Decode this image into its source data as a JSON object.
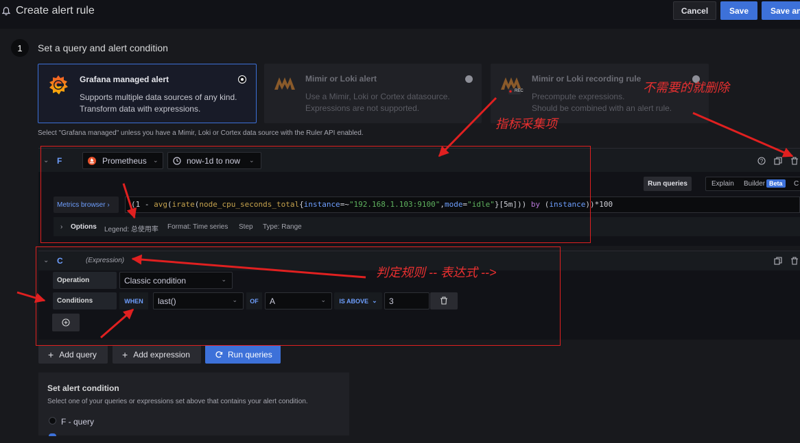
{
  "header": {
    "title": "Create alert rule",
    "cancel": "Cancel",
    "save": "Save",
    "save_exit": "Save and exit"
  },
  "step": {
    "number": "1",
    "title": "Set a query and alert condition"
  },
  "rule_types": [
    {
      "title": "Grafana managed alert",
      "line1": "Supports multiple data sources of any kind.",
      "line2": "Transform data with expressions.",
      "selected": true
    },
    {
      "title": "Mimir or Loki alert",
      "line1": "Use a Mimir, Loki or Cortex datasource.",
      "line2": "Expressions are not supported.",
      "selected": false
    },
    {
      "title": "Mimir or Loki recording rule",
      "line1": "Precompute expressions.",
      "line2": "Should be combined with an alert rule.",
      "selected": false,
      "badge": "REC"
    }
  ],
  "hint": "Select \"Grafana managed\" unless you have a Mimir, Loki or Cortex data source with the Ruler API enabled.",
  "query_f": {
    "ref": "F",
    "datasource": "Prometheus",
    "time_range": "now-1d to now",
    "run_queries": "Run queries",
    "mode": {
      "explain": "Explain",
      "builder": "Builder",
      "beta": "Beta",
      "code": "C"
    },
    "metrics_browser": "Metrics browser ›",
    "expr": {
      "p1": "(1 - ",
      "fn1": "avg",
      "p2": "(",
      "fn2": "irate",
      "p3": "(",
      "metric": "node_cpu_seconds_total",
      "p4": "{",
      "l1": "instance",
      "op1": "=~",
      "s1": "\"192.168.1.103:9100\"",
      "p5": ",",
      "l2": "mode",
      "op2": "=",
      "s2": "\"idle\"",
      "p6": "}[5m])) ",
      "kw": "by",
      "p7": " (",
      "l3": "instance",
      "p8": "))*100"
    },
    "options": {
      "label": "Options",
      "legend": "Legend: 总使用率",
      "format": "Format: Time series",
      "step": "Step",
      "type": "Type: Range"
    }
  },
  "expr_c": {
    "ref": "C",
    "kind": "(Expression)",
    "operation_label": "Operation",
    "operation_value": "Classic condition",
    "conditions_label": "Conditions",
    "when": "WHEN",
    "reducer": "last()",
    "of": "OF",
    "query": "A",
    "evaluator": "IS ABOVE",
    "threshold": "3"
  },
  "actions": {
    "add_query": "Add query",
    "add_expression": "Add expression",
    "run_queries": "Run queries"
  },
  "set_condition": {
    "title": "Set alert condition",
    "desc": "Select one of your queries or expressions set above that contains your alert condition.",
    "option1": "F - query"
  },
  "annotations": {
    "delete_unneeded": "不需要的就删除",
    "metric_collection": "指标采集项",
    "judge_rule": "判定规则 -- 表达式 -->"
  },
  "colors": {
    "accent": "#3d71d9",
    "annotation": "#e02020",
    "ref_blue": "#6e9fff"
  }
}
